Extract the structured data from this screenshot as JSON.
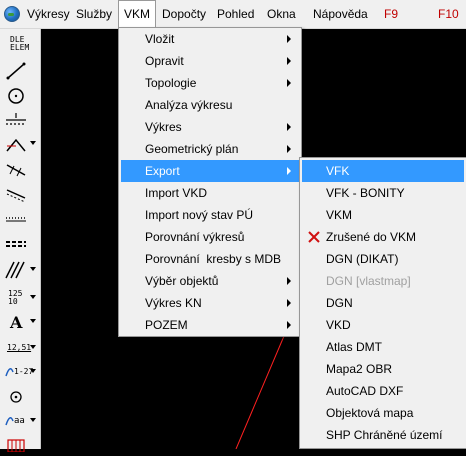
{
  "menubar": {
    "items": [
      "Výkresy",
      "Služby",
      "VKM",
      "Dopočty",
      "Pohled",
      "Okna",
      "Nápověda",
      "F9",
      "F10"
    ]
  },
  "toolbar": {
    "dle_elem": "DLE\nELEM",
    "text_125": "125\n10",
    "text_A": "A",
    "text_1251": "12,51",
    "text_127": "1-27",
    "text_aa": "aa"
  },
  "vkm_menu": {
    "items": [
      {
        "label": "Vložit",
        "submenu": true
      },
      {
        "label": "Opravit",
        "submenu": true
      },
      {
        "label": "Topologie",
        "submenu": true
      },
      {
        "label": "Analýza výkresu",
        "submenu": false
      },
      {
        "label": "Výkres",
        "submenu": true
      },
      {
        "label": "Geometrický plán",
        "submenu": true
      },
      {
        "label": "Export",
        "submenu": true
      },
      {
        "label": "Import VKD",
        "submenu": false
      },
      {
        "label": "Import nový stav PÚ",
        "submenu": false
      },
      {
        "label": "Porovnání výkresů",
        "submenu": false
      },
      {
        "label": "Porovnání  kresby s MDB",
        "submenu": false
      },
      {
        "label": "Výběr objektů",
        "submenu": true
      },
      {
        "label": "Výkres KN",
        "submenu": true
      },
      {
        "label": "POZEM",
        "submenu": true
      }
    ],
    "active": "Export"
  },
  "export_menu": {
    "items": [
      {
        "label": "VFK",
        "state": "active"
      },
      {
        "label": "VFK - BONITY",
        "state": "normal"
      },
      {
        "label": "VKM",
        "state": "normal"
      },
      {
        "label": "Zrušené do VKM",
        "state": "normal",
        "icon": "red-x-icon"
      },
      {
        "label": "DGN (DIKAT)",
        "state": "normal"
      },
      {
        "label": "DGN [vlastmap]",
        "state": "disabled"
      },
      {
        "label": "DGN",
        "state": "normal"
      },
      {
        "label": "VKD",
        "state": "normal"
      },
      {
        "label": "Atlas DMT",
        "state": "normal"
      },
      {
        "label": "Mapa2 OBR",
        "state": "normal"
      },
      {
        "label": "AutoCAD DXF",
        "state": "normal"
      },
      {
        "label": "Objektová mapa",
        "state": "normal"
      },
      {
        "label": "SHP Chráněné území",
        "state": "normal"
      }
    ]
  },
  "colors": {
    "highlight": "#3399ff",
    "menu_bg": "#f0f0f0",
    "canvas_bg": "#000000",
    "accent_red": "#c00000",
    "canvas_line": "#ff0000"
  }
}
